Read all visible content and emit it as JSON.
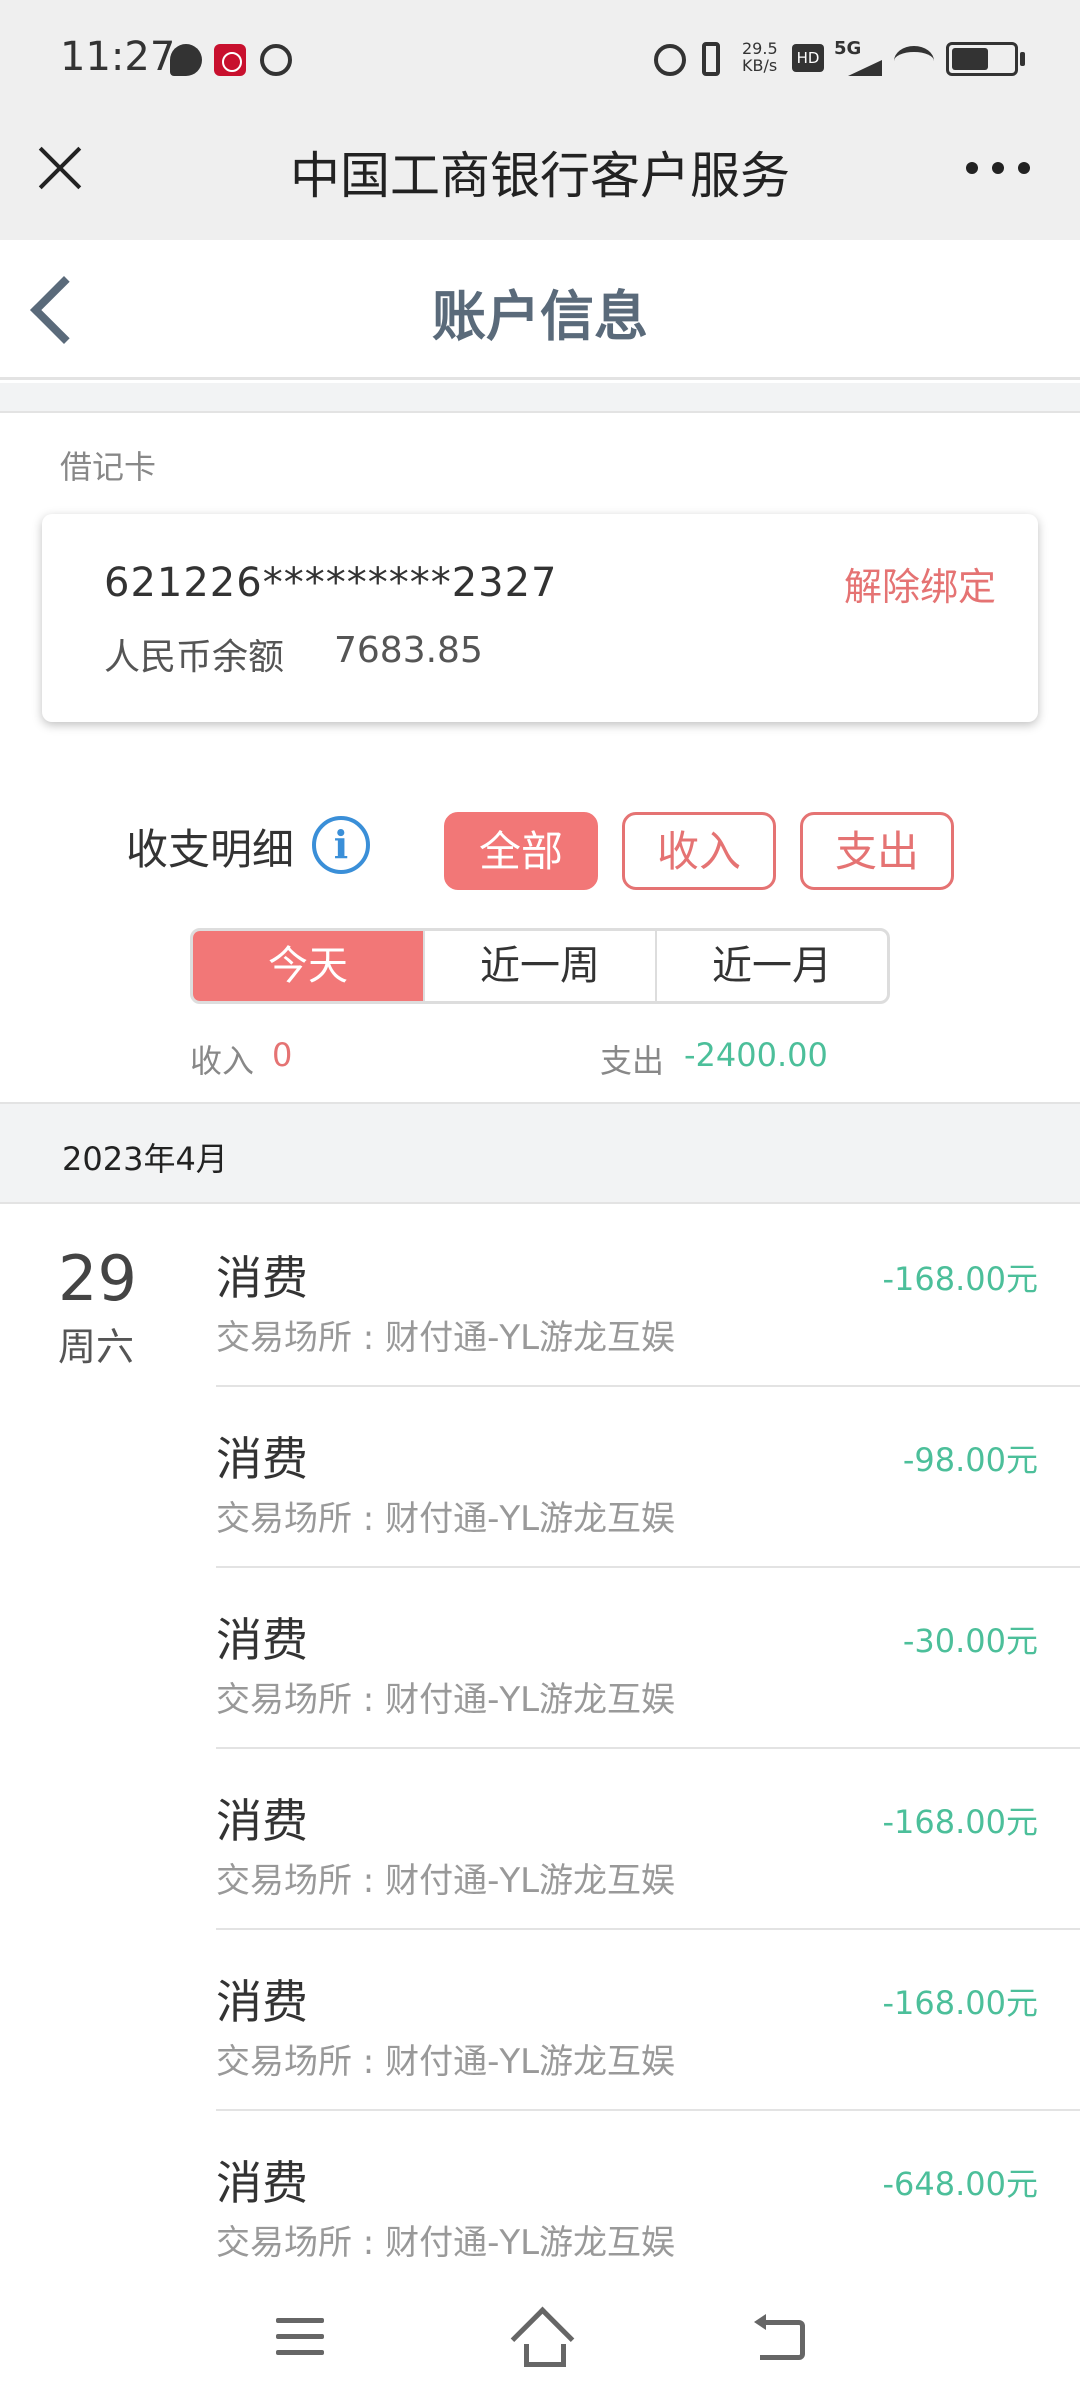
{
  "status_bar": {
    "time": "11:27",
    "net_speed": "29.5 KB/s",
    "hd": "HD",
    "signal": "5G"
  },
  "titlebar": {
    "title": "中国工商银行客户服务"
  },
  "page": {
    "title": "账户信息"
  },
  "card": {
    "type": "借记卡",
    "number": "621226*********2327",
    "unbind_label": "解除绑定",
    "balance_label": "人民币余额",
    "balance_value": "7683.85"
  },
  "details": {
    "label": "收支明细",
    "filters": [
      "全部",
      "收入",
      "支出"
    ],
    "periods": [
      "今天",
      "近一周",
      "近一月"
    ],
    "income_label": "收入",
    "income_value": "0",
    "expense_label": "支出",
    "expense_value": "-2400.00"
  },
  "month": "2023年4月",
  "day": {
    "date": "29",
    "weekday": "周六"
  },
  "transactions": [
    {
      "title": "消费",
      "place": "交易场所 : 财付通-YL游龙互娱",
      "amount": "-168.00元"
    },
    {
      "title": "消费",
      "place": "交易场所 : 财付通-YL游龙互娱",
      "amount": "-98.00元"
    },
    {
      "title": "消费",
      "place": "交易场所 : 财付通-YL游龙互娱",
      "amount": "-30.00元"
    },
    {
      "title": "消费",
      "place": "交易场所 : 财付通-YL游龙互娱",
      "amount": "-168.00元"
    },
    {
      "title": "消费",
      "place": "交易场所 : 财付通-YL游龙互娱",
      "amount": "-168.00元"
    },
    {
      "title": "消费",
      "place": "交易场所 : 财付通-YL游龙互娱",
      "amount": "-648.00元"
    }
  ],
  "colors": {
    "accent": "#f27777",
    "expense_green": "#4cbf9a",
    "info_blue": "#3a8fd8"
  },
  "icons": [
    "message-icon",
    "bank-app-icon",
    "status-circle-icon",
    "alarm-icon",
    "vibrate-icon",
    "wifi-icon",
    "battery-icon",
    "close-icon",
    "more-icon",
    "back-icon",
    "info-icon",
    "menu-icon",
    "home-icon",
    "nav-back-icon"
  ]
}
